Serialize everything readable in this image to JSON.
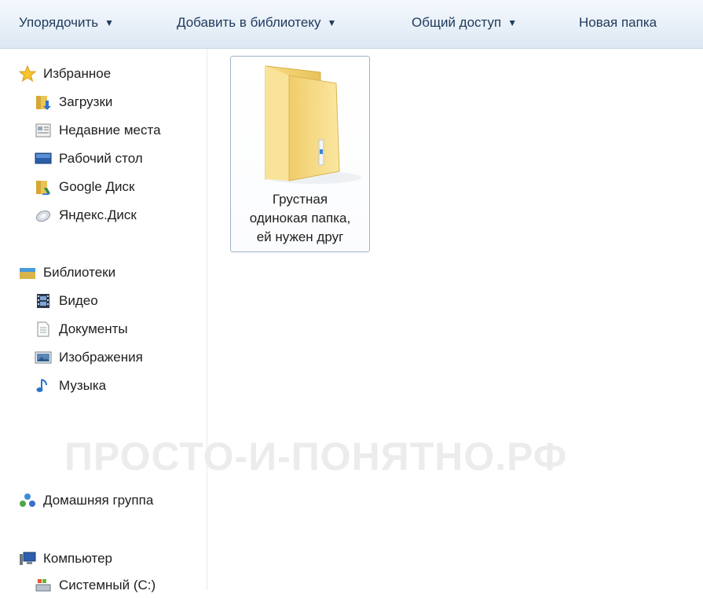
{
  "toolbar": {
    "organize": "Упорядочить",
    "add_to_library": "Добавить в библиотеку",
    "share": "Общий доступ",
    "new_folder": "Новая папка"
  },
  "nav": {
    "favorites": {
      "label": "Избранное",
      "items": [
        "Загрузки",
        "Недавние места",
        "Рабочий стол",
        "Google Диск",
        "Яндекс.Диск"
      ]
    },
    "libraries": {
      "label": "Библиотеки",
      "items": [
        "Видео",
        "Документы",
        "Изображения",
        "Музыка"
      ]
    },
    "homegroup": "Домашняя группа",
    "computer": {
      "label": "Компьютер",
      "items": [
        "Системный (C:)"
      ]
    }
  },
  "content": {
    "folder": {
      "name_lines": [
        "Грустная",
        "одинокая папка,",
        "ей нужен друг"
      ]
    }
  },
  "watermark": "ПРОСТО-И-ПОНЯТНО.РФ",
  "colors": {
    "toolbar_text": "#1e395b",
    "selection_border": "#9fb3c8",
    "folder_yellow": "#f6d874"
  }
}
